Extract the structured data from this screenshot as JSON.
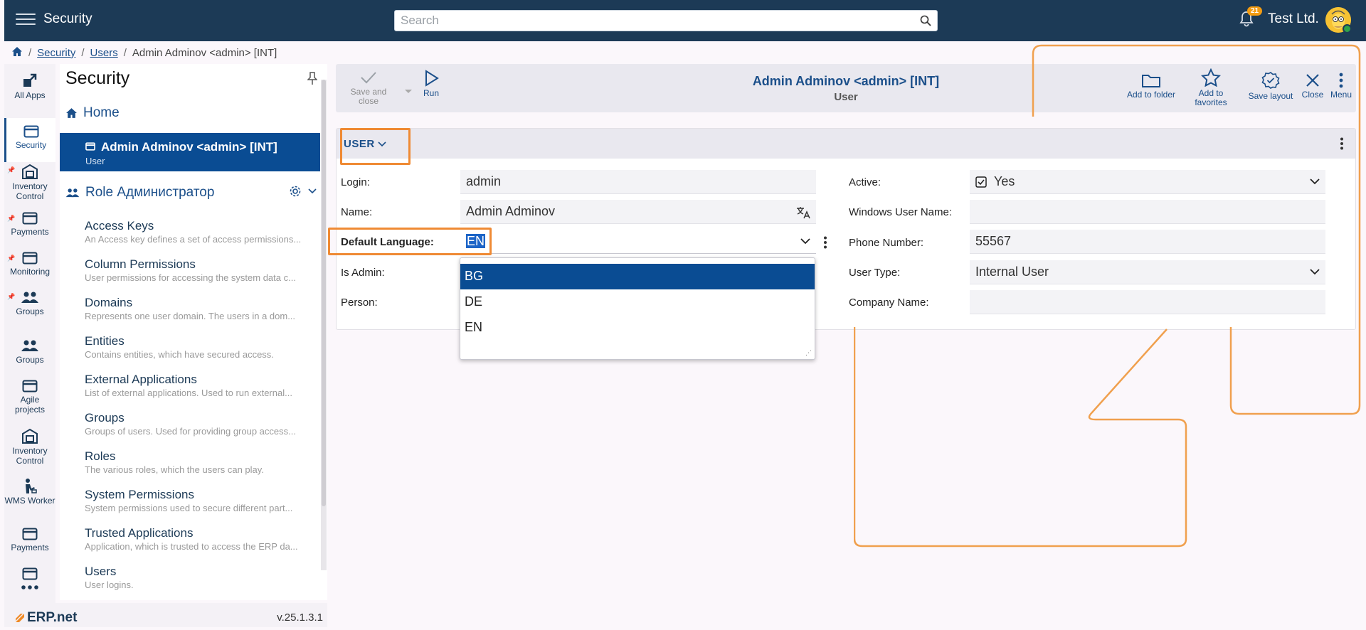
{
  "header": {
    "app_title": "Security",
    "search_placeholder": "Search",
    "notifications_count": "21",
    "company": "Test Ltd."
  },
  "breadcrumb": {
    "items": [
      "Security",
      "Users"
    ],
    "current": "Admin Adminov <admin> [INT]"
  },
  "rail": {
    "items": [
      {
        "label": "All Apps",
        "icon": "grid-arrow-icon"
      },
      {
        "label": "Security",
        "icon": "window-icon"
      },
      {
        "label": "Inventory Control",
        "icon": "warehouse-icon"
      },
      {
        "label": "Payments",
        "icon": "window-icon"
      },
      {
        "label": "Monitoring",
        "icon": "window-icon"
      },
      {
        "label": "Groups",
        "icon": "people-icon"
      },
      {
        "label": "Groups",
        "icon": "people-icon"
      },
      {
        "label": "Agile projects",
        "icon": "window-icon"
      },
      {
        "label": "Inventory Control",
        "icon": "warehouse-icon"
      },
      {
        "label": "WMS Worker",
        "icon": "worker-icon"
      },
      {
        "label": "Payments",
        "icon": "window-icon"
      }
    ]
  },
  "sidenav": {
    "title": "Security",
    "home": "Home",
    "active": {
      "title": "Admin Adminov <admin> [INT]",
      "subtitle": "User"
    },
    "role": "Role Администратор",
    "entries": [
      {
        "title": "Access Keys",
        "desc": "An Access key defines a set of access permissions..."
      },
      {
        "title": "Column Permissions",
        "desc": "User permissions for accessing the system data c..."
      },
      {
        "title": "Domains",
        "desc": "Represents one user domain. The users in a dom..."
      },
      {
        "title": "Entities",
        "desc": "Contains entities, which have secured access."
      },
      {
        "title": "External Applications",
        "desc": "List of external applications. Used to run external..."
      },
      {
        "title": "Groups",
        "desc": "Groups of users. Used for providing group access..."
      },
      {
        "title": "Roles",
        "desc": "The various roles, which the users can play."
      },
      {
        "title": "System Permissions",
        "desc": "System permissions used to secure different part..."
      },
      {
        "title": "Trusted Applications",
        "desc": "Application, which is trusted to access the ERP da..."
      },
      {
        "title": "Users",
        "desc": "User logins."
      }
    ]
  },
  "footer": {
    "logo": "ERP.net",
    "version": "v.25.1.3.1"
  },
  "toolbar": {
    "save_close": "Save and close",
    "run": "Run",
    "record_title": "Admin Adminov <admin> [INT]",
    "record_type": "User",
    "add_folder": "Add to folder",
    "add_favorites": "Add to favorites",
    "save_layout": "Save layout",
    "close": "Close",
    "menu": "Menu"
  },
  "section": {
    "title": "USER",
    "fields": {
      "login_label": "Login:",
      "login_value": "admin",
      "name_label": "Name:",
      "name_value": "Admin Adminov",
      "default_language_label": "Default Language:",
      "default_language_value": "EN",
      "is_admin_label": "Is Admin:",
      "person_label": "Person:",
      "active_label": "Active:",
      "active_value": "Yes",
      "windows_user_label": "Windows User Name:",
      "windows_user_value": "",
      "phone_label": "Phone Number:",
      "phone_value": "55567",
      "user_type_label": "User Type:",
      "user_type_value": "Internal User",
      "company_label": "Company Name:",
      "company_value": ""
    }
  },
  "language_dropdown": {
    "options": [
      "BG",
      "DE",
      "EN"
    ],
    "highlighted": "BG"
  },
  "colors": {
    "topbar": "#1c3a56",
    "accent": "#0a4c93",
    "highlight": "#ef8a34",
    "notification_badge": "#f39c12"
  }
}
